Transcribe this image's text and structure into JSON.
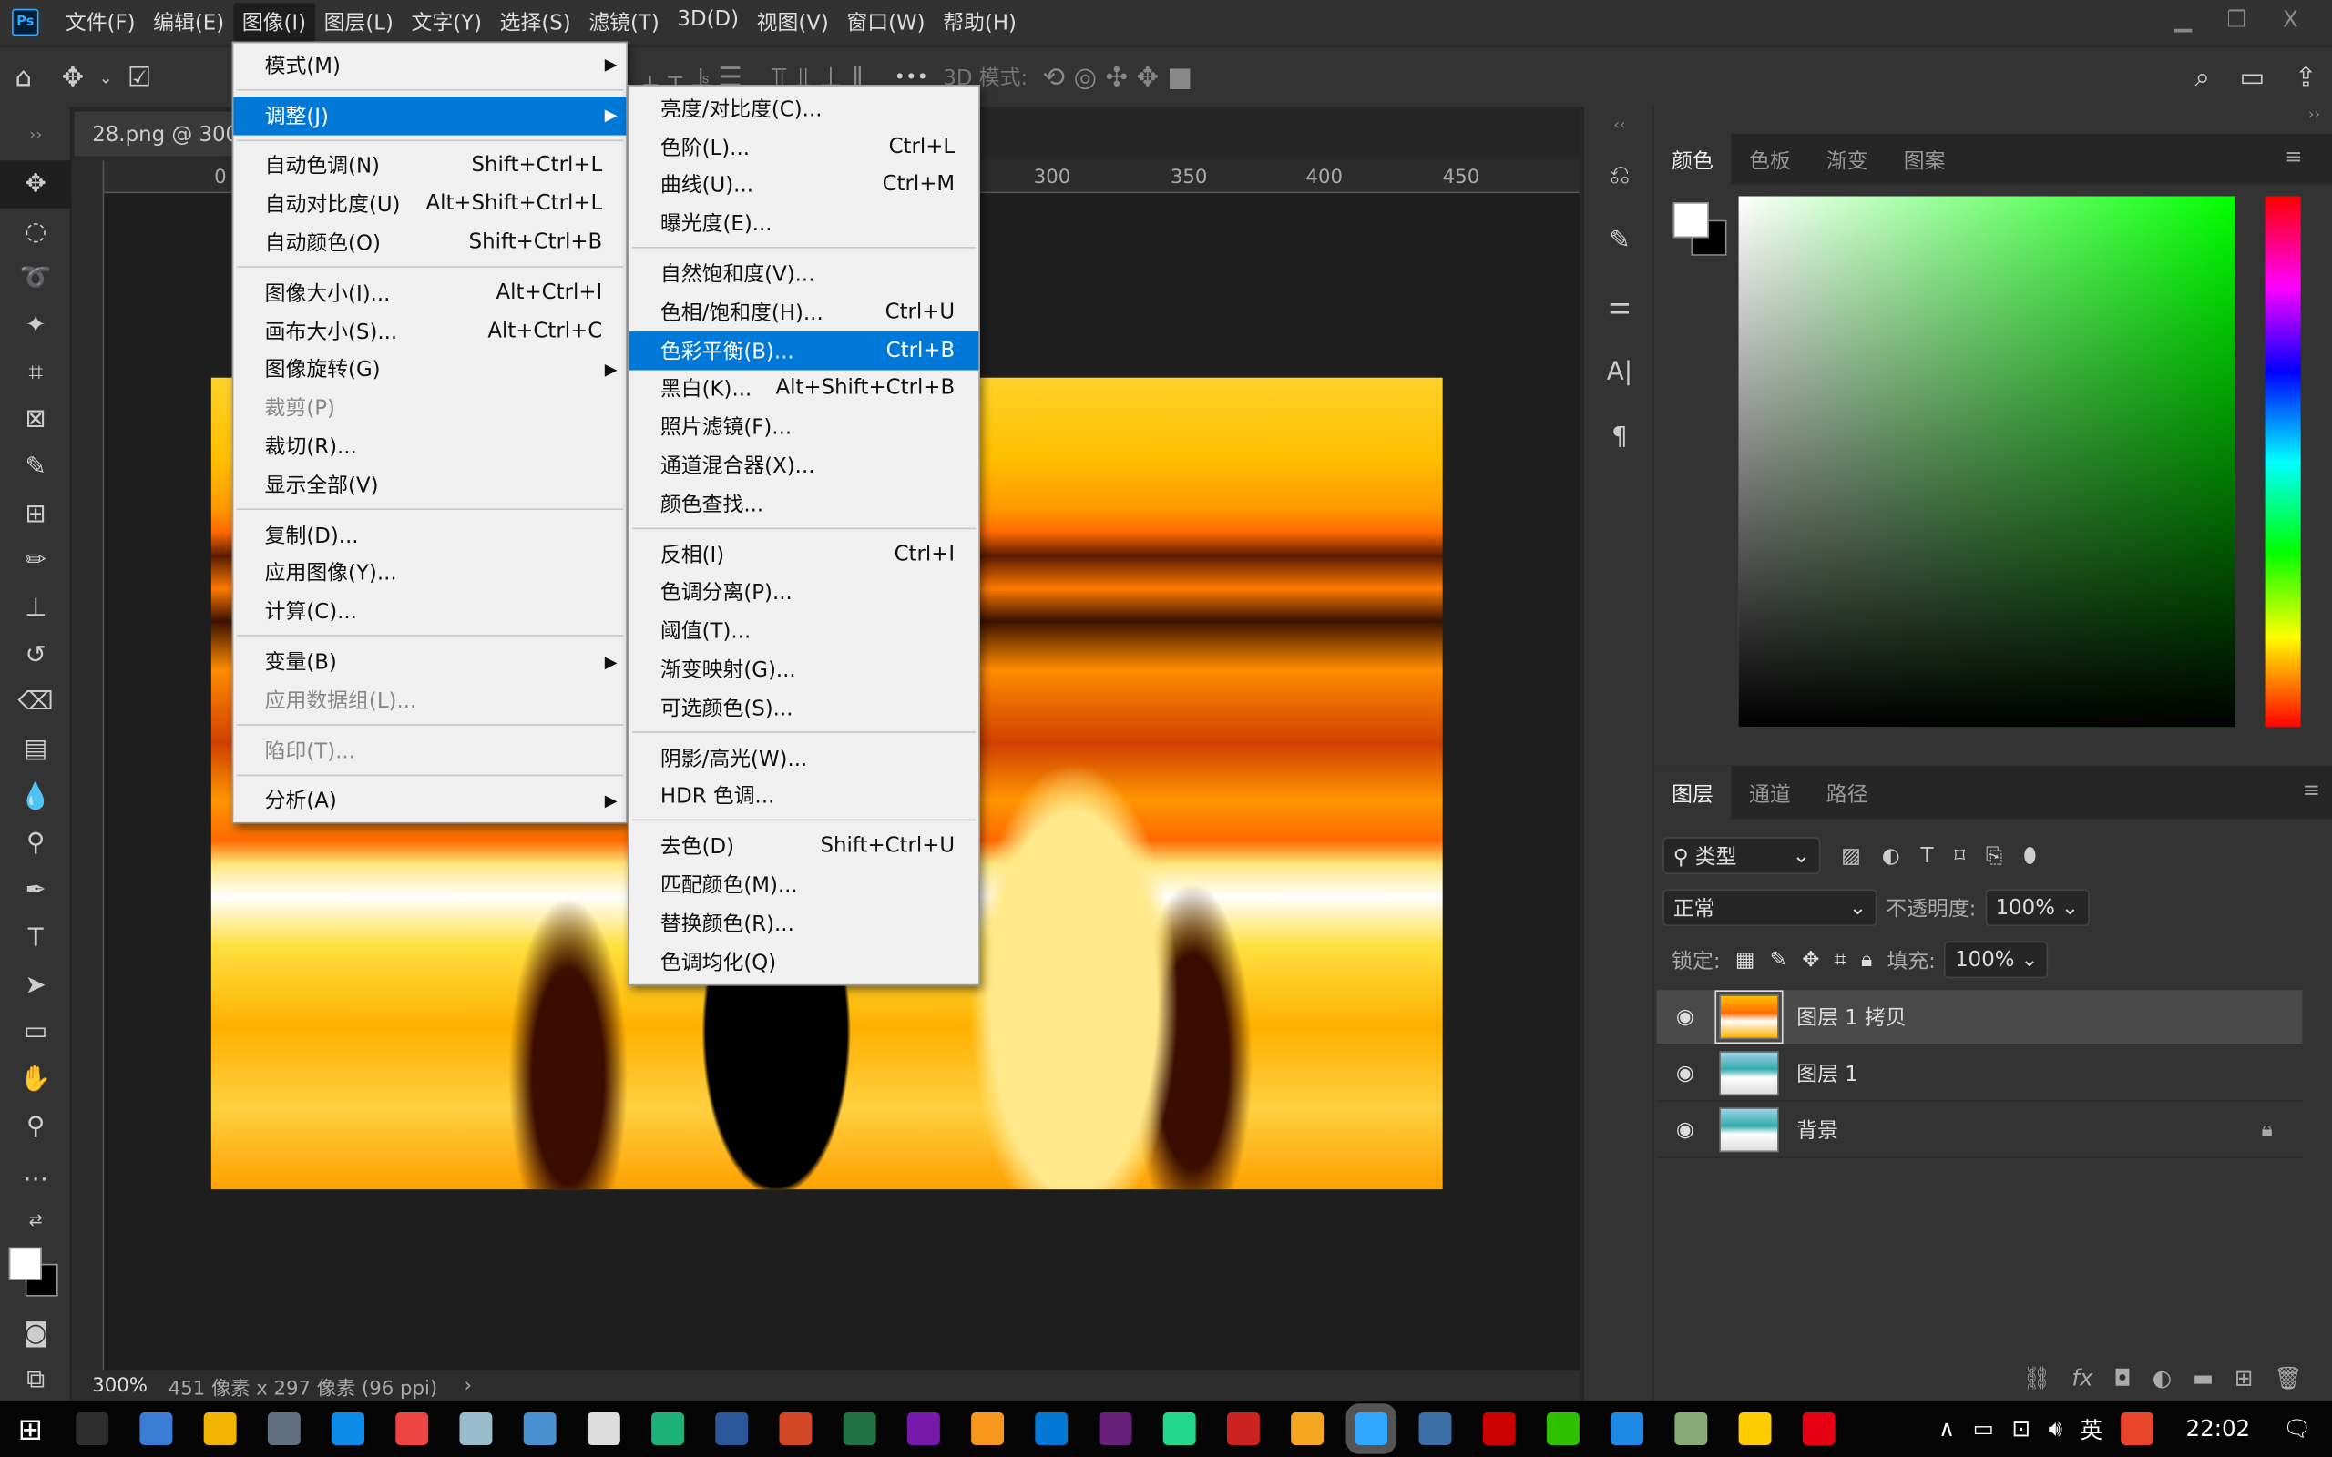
{
  "app": {
    "logo": "Ps",
    "accent": "#31a8ff"
  },
  "menubar": [
    "文件(F)",
    "编辑(E)",
    "图像(I)",
    "图层(L)",
    "文字(Y)",
    "选择(S)",
    "滤镜(T)",
    "3D(D)",
    "视图(V)",
    "窗口(W)",
    "帮助(H)"
  ],
  "window_controls": {
    "minimize": "▁",
    "restore": "❐",
    "close": "X"
  },
  "options": {
    "mode3d": "3D 模式:",
    "more": "•••"
  },
  "document_tab": "28.png @ 300% (图层 1 拷贝, RGB/8)",
  "ruler_h": [
    "0",
    "300",
    "350",
    "400",
    "450"
  ],
  "image_menu": [
    {
      "label": "模式(M)",
      "sub": true
    },
    {
      "sep": true
    },
    {
      "label": "调整(J)",
      "sub": true,
      "highlight": true
    },
    {
      "sep": true
    },
    {
      "label": "自动色调(N)",
      "shortcut": "Shift+Ctrl+L"
    },
    {
      "label": "自动对比度(U)",
      "shortcut": "Alt+Shift+Ctrl+L"
    },
    {
      "label": "自动颜色(O)",
      "shortcut": "Shift+Ctrl+B"
    },
    {
      "sep": true
    },
    {
      "label": "图像大小(I)...",
      "shortcut": "Alt+Ctrl+I"
    },
    {
      "label": "画布大小(S)...",
      "shortcut": "Alt+Ctrl+C"
    },
    {
      "label": "图像旋转(G)",
      "sub": true
    },
    {
      "label": "裁剪(P)",
      "disabled": true
    },
    {
      "label": "裁切(R)..."
    },
    {
      "label": "显示全部(V)"
    },
    {
      "sep": true
    },
    {
      "label": "复制(D)..."
    },
    {
      "label": "应用图像(Y)..."
    },
    {
      "label": "计算(C)..."
    },
    {
      "sep": true
    },
    {
      "label": "变量(B)",
      "sub": true
    },
    {
      "label": "应用数据组(L)...",
      "disabled": true
    },
    {
      "sep": true
    },
    {
      "label": "陷印(T)...",
      "disabled": true
    },
    {
      "sep": true
    },
    {
      "label": "分析(A)",
      "sub": true
    }
  ],
  "adjust_menu": [
    {
      "label": "亮度/对比度(C)..."
    },
    {
      "label": "色阶(L)...",
      "shortcut": "Ctrl+L"
    },
    {
      "label": "曲线(U)...",
      "shortcut": "Ctrl+M"
    },
    {
      "label": "曝光度(E)..."
    },
    {
      "sep": true
    },
    {
      "label": "自然饱和度(V)..."
    },
    {
      "label": "色相/饱和度(H)...",
      "shortcut": "Ctrl+U"
    },
    {
      "label": "色彩平衡(B)...",
      "shortcut": "Ctrl+B",
      "highlight": true
    },
    {
      "label": "黑白(K)...",
      "shortcut": "Alt+Shift+Ctrl+B"
    },
    {
      "label": "照片滤镜(F)..."
    },
    {
      "label": "通道混合器(X)..."
    },
    {
      "label": "颜色查找..."
    },
    {
      "sep": true
    },
    {
      "label": "反相(I)",
      "shortcut": "Ctrl+I"
    },
    {
      "label": "色调分离(P)..."
    },
    {
      "label": "阈值(T)..."
    },
    {
      "label": "渐变映射(G)..."
    },
    {
      "label": "可选颜色(S)..."
    },
    {
      "sep": true
    },
    {
      "label": "阴影/高光(W)..."
    },
    {
      "label": "HDR 色调..."
    },
    {
      "sep": true
    },
    {
      "label": "去色(D)",
      "shortcut": "Shift+Ctrl+U"
    },
    {
      "label": "匹配颜色(M)..."
    },
    {
      "label": "替换颜色(R)..."
    },
    {
      "label": "色调均化(Q)"
    }
  ],
  "color_panel": {
    "tabs": [
      "颜色",
      "色板",
      "渐变",
      "图案"
    ],
    "foreground": "#ffffff",
    "background": "#000000",
    "hue_color": "#00ff00"
  },
  "layers_panel": {
    "tabs": [
      "图层",
      "通道",
      "路径"
    ],
    "filter": "类型",
    "blend": "正常",
    "opacity_label": "不透明度:",
    "opacity": "100%",
    "lock_label": "锁定:",
    "fill_label": "填充:",
    "fill": "100%",
    "layers": [
      {
        "name": "图层 1 拷贝",
        "selected": true
      },
      {
        "name": "图层 1"
      },
      {
        "name": "背景",
        "locked": true
      }
    ]
  },
  "status": {
    "zoom": "300%",
    "info": "451 像素 x 297 像素 (96 ppi)"
  },
  "taskbar": {
    "time": "22:02",
    "ime": "英"
  }
}
